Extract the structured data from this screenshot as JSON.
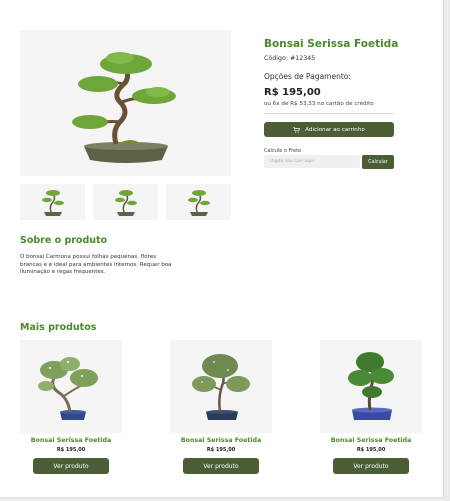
{
  "product": {
    "title": "Bonsai Serissa Foetida",
    "code_label": "Código:",
    "code_value": "#12345",
    "payment_label": "Opções de Pagamento:",
    "price": "R$ 195,00",
    "installments": "ou 6x de R$ 53,33 no cartão de crédito",
    "add_to_cart": "Adicionar ao carrinho",
    "cart_icon": "cart-icon"
  },
  "freight": {
    "label": "Calcule o Frete",
    "placeholder": "Digite seu CEP aqui",
    "button": "Calcular"
  },
  "about": {
    "title": "Sobre o produto",
    "text": "O bonsai Carmona possui folhas pequenas, flores brancas e é ideal para ambientes internos. Requer boa iluminação e regas frequentes."
  },
  "more": {
    "title": "Mais produtos",
    "items": [
      {
        "name": "Bonsai Serissa Foetida",
        "price": "R$ 195,00",
        "button": "Ver produto"
      },
      {
        "name": "Bonsai Serissa Foetida",
        "price": "R$ 195,00",
        "button": "Ver produto"
      },
      {
        "name": "Bonsai Serissa Foetida",
        "price": "R$ 195,00",
        "button": "Ver produto"
      }
    ]
  },
  "colors": {
    "accent_green": "#4a8a2a",
    "button_dark_green": "#4b5e36",
    "image_background": "#f5f5f5"
  }
}
